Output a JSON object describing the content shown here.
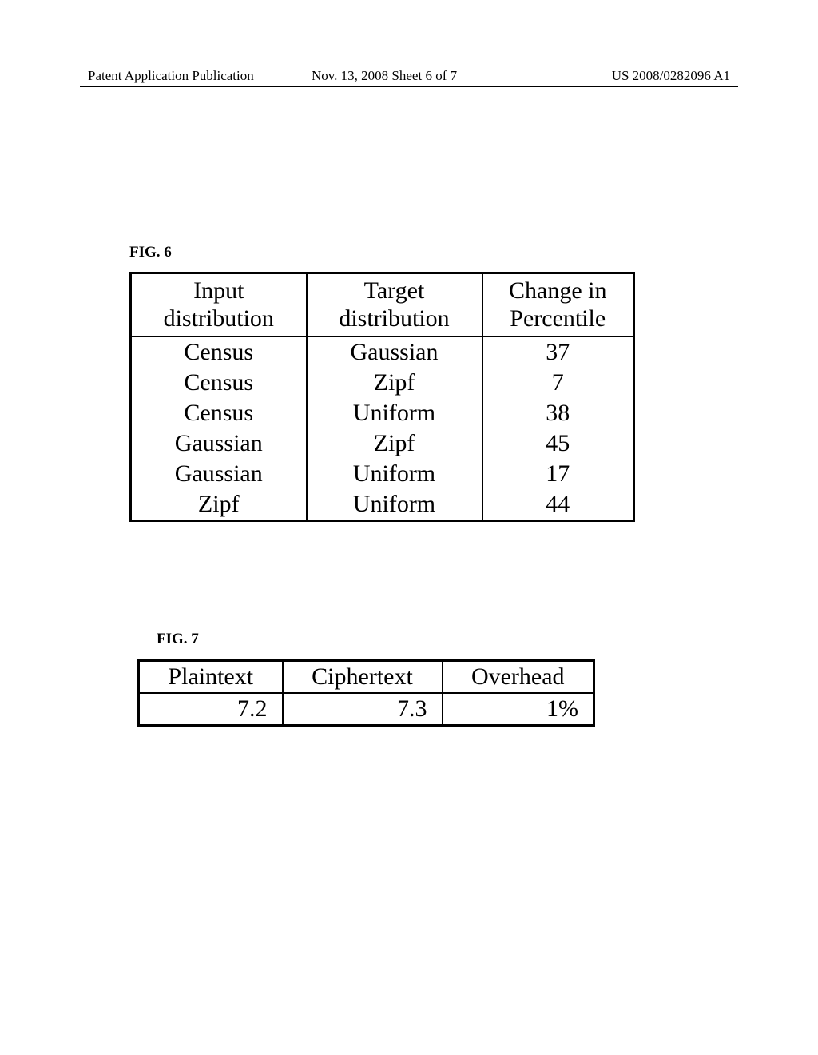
{
  "header": {
    "left": "Patent Application Publication",
    "center": "Nov. 13, 2008  Sheet 6 of 7",
    "right": "US 2008/0282096 A1"
  },
  "fig6": {
    "label": "FIG. 6",
    "headers": {
      "col1_line1": "Input",
      "col1_line2": "distribution",
      "col2_line1": "Target",
      "col2_line2": "distribution",
      "col3_line1": "Change in",
      "col3_line2": "Percentile"
    },
    "rows": [
      {
        "input": "Census",
        "target": "Gaussian",
        "change": "37"
      },
      {
        "input": "Census",
        "target": "Zipf",
        "change": "7"
      },
      {
        "input": "Census",
        "target": "Uniform",
        "change": "38"
      },
      {
        "input": "Gaussian",
        "target": "Zipf",
        "change": "45"
      },
      {
        "input": "Gaussian",
        "target": "Uniform",
        "change": "17"
      },
      {
        "input": "Zipf",
        "target": "Uniform",
        "change": "44"
      }
    ]
  },
  "fig7": {
    "label": "FIG. 7",
    "headers": {
      "col1": "Plaintext",
      "col2": "Ciphertext",
      "col3": "Overhead"
    },
    "row": {
      "plaintext": "7.2",
      "ciphertext": "7.3",
      "overhead": "1%"
    }
  },
  "chart_data": [
    {
      "type": "table",
      "title": "FIG. 6",
      "columns": [
        "Input distribution",
        "Target distribution",
        "Change in Percentile"
      ],
      "rows": [
        [
          "Census",
          "Gaussian",
          37
        ],
        [
          "Census",
          "Zipf",
          7
        ],
        [
          "Census",
          "Uniform",
          38
        ],
        [
          "Gaussian",
          "Zipf",
          45
        ],
        [
          "Gaussian",
          "Uniform",
          17
        ],
        [
          "Zipf",
          "Uniform",
          44
        ]
      ]
    },
    {
      "type": "table",
      "title": "FIG. 7",
      "columns": [
        "Plaintext",
        "Ciphertext",
        "Overhead"
      ],
      "rows": [
        [
          7.2,
          7.3,
          "1%"
        ]
      ]
    }
  ]
}
